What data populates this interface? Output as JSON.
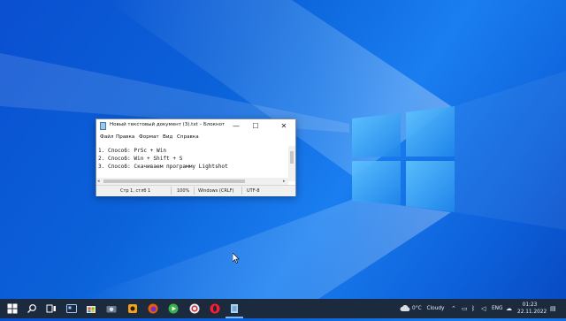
{
  "notepad": {
    "title": "Новый текстовый документ (3).txt – Блокнот",
    "controls": {
      "minimize": "—",
      "maximize": "☐",
      "close": "✕"
    },
    "menu": [
      "Файл",
      "Правка",
      "Формат",
      "Вид",
      "Справка"
    ],
    "lines": [
      "1. Способ: PrSc + Win",
      "2. Способ: Win + Shift + S",
      "3. Способ: Скачиваем программу Lightshot"
    ],
    "status": {
      "position": "Стр 1, стлб 1",
      "zoom": "100%",
      "line_endings": "Windows (CRLF)",
      "encoding": "UTF-8"
    }
  },
  "taskbar": {
    "weather": {
      "temp": "0°C",
      "condition": "Cloudy"
    },
    "language": "ENG",
    "time": "01:23",
    "date": "22.11.2022",
    "icons": [
      "windows-start-icon",
      "search-icon",
      "task-view-icon",
      "widgets-icon",
      "store-icon",
      "camera-icon",
      "game-icon",
      "firefox-icon",
      "media-icon",
      "vpn-icon",
      "opera-icon",
      "chrome-icon",
      "notepad-icon"
    ]
  }
}
